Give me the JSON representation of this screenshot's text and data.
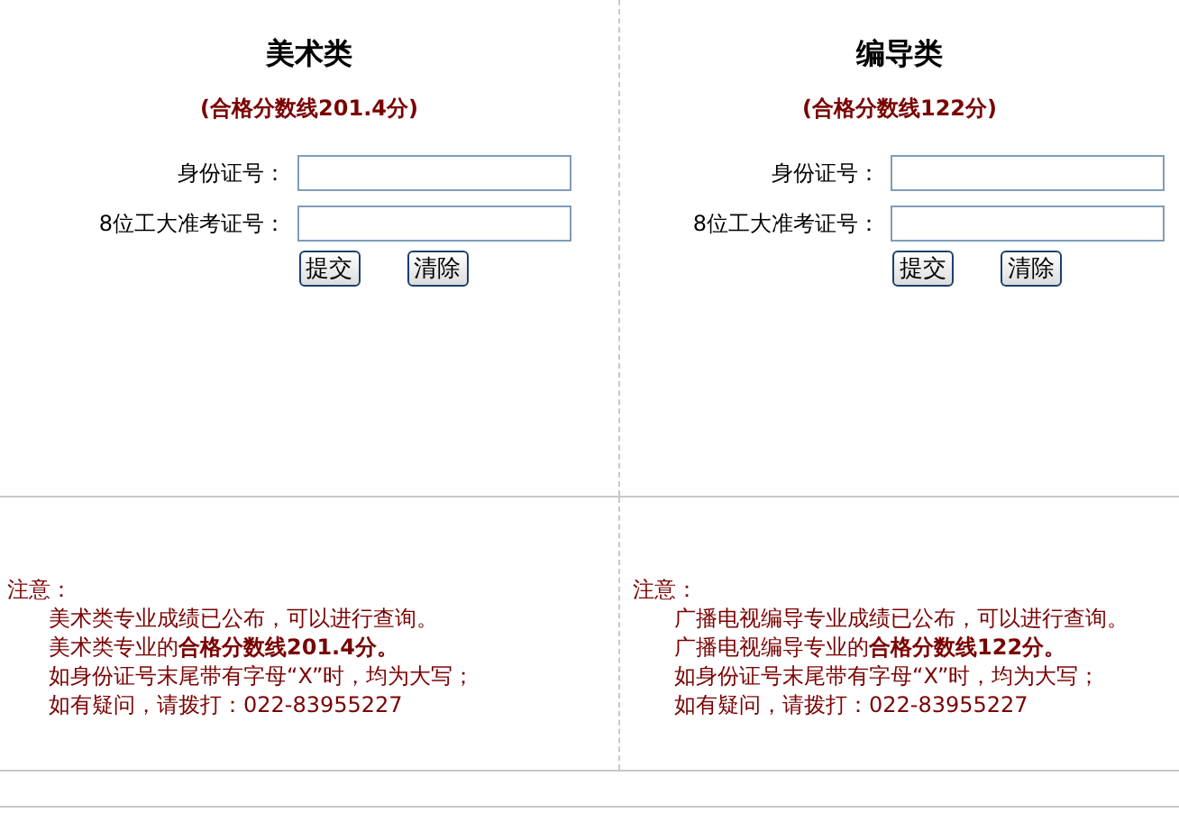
{
  "panels": [
    {
      "title": "美术类",
      "subtitle": "(合格分数线201.4分)",
      "fields": [
        {
          "label": "身份证号："
        },
        {
          "label": "8位工大准考证号："
        }
      ],
      "buttons": [
        "提交",
        "清除"
      ],
      "notice": {
        "heading": "注意：",
        "lines": [
          "美术类专业成绩已公布，可以进行查询。",
          "美术类专业的**合格分数线201.4分。**",
          "如身份证号末尾带有字母“X”时，均为大写；",
          "如有疑问，请拨打：022-83955227"
        ]
      }
    },
    {
      "title": "编导类",
      "subtitle": "(合格分数线122分)",
      "fields": [
        {
          "label": "身份证号："
        },
        {
          "label": "8位工大准考证号："
        }
      ],
      "buttons": [
        "提交",
        "清除"
      ],
      "notice": {
        "heading": "注意：",
        "lines": [
          "广播电视编导专业成绩已公布，可以进行查询。",
          "广播电视编导专业的**合格分数线122分。**",
          "如身份证号末尾带有字母“X”时，均为大写；",
          "如有疑问，请拨打：022-83955227"
        ]
      }
    }
  ]
}
